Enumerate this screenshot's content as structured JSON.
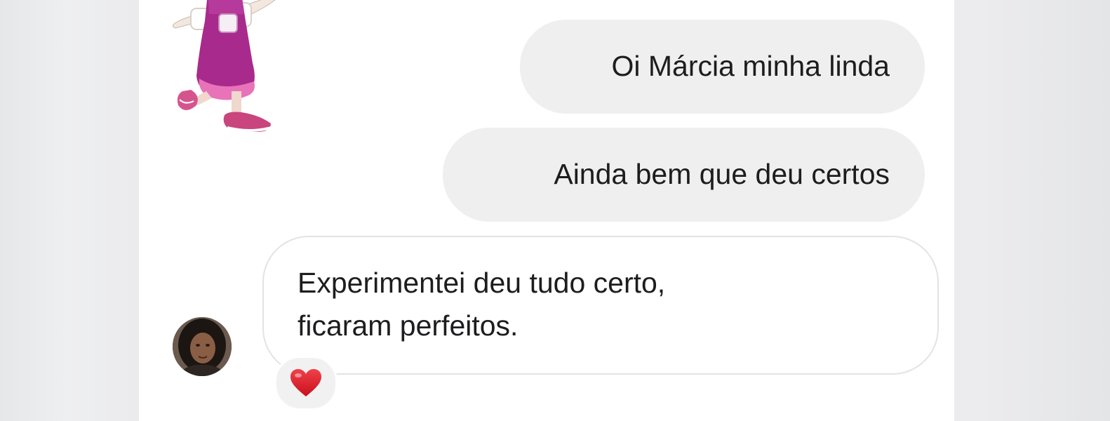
{
  "conversation": {
    "messages": [
      {
        "direction": "sent",
        "text": "Oi Márcia minha linda"
      },
      {
        "direction": "sent",
        "text": "Ainda bem que deu certos"
      },
      {
        "direction": "received",
        "lines": [
          "Experimentei deu tudo certo,",
          "ficaram perfeitos."
        ],
        "reaction": "heart-emoji"
      }
    ],
    "sticker": "masha-dancing-sticker",
    "contact_avatar": "contact-avatar-photo"
  },
  "colors": {
    "sent_bubble": "#efefef",
    "received_bubble_border": "#e3e3e3",
    "text": "#1d1d1f",
    "reaction": "#e0222c"
  }
}
